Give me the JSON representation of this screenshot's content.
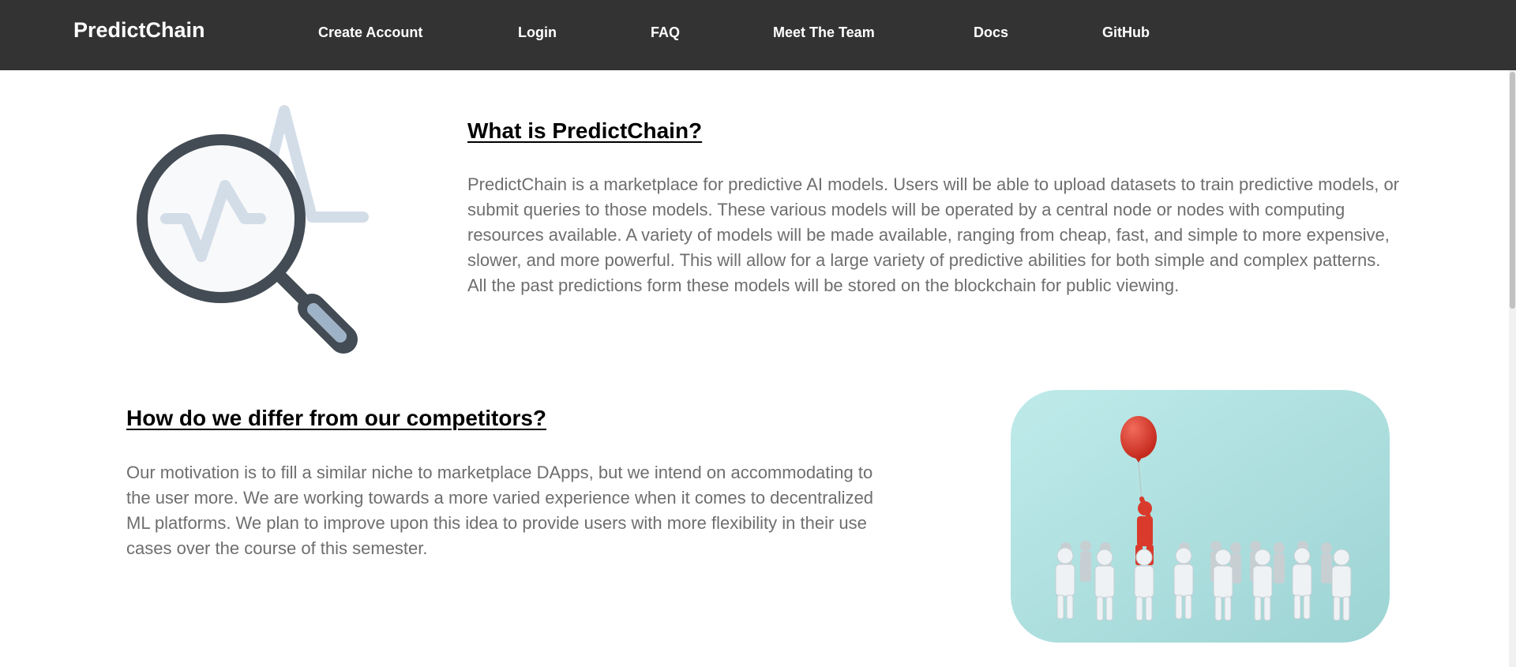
{
  "nav": {
    "brand": "PredictChain",
    "links": [
      "Create Account",
      "Login",
      "FAQ",
      "Meet The Team",
      "Docs",
      "GitHub"
    ]
  },
  "section_what": {
    "heading": "What is PredictChain?",
    "body": "PredictChain is a marketplace for predictive AI models. Users will be able to upload datasets to train predictive models, or submit queries to those models. These various models will be operated by a central node or nodes with computing resources available. A variety of models will be made available, ranging from cheap, fast, and simple to more expensive, slower, and more powerful. This will allow for a large variety of predictive abilities for both simple and complex patterns. All the past predictions form these models will be stored on the blockchain for public viewing.",
    "image_icon": "magnifier-with-chart-icon"
  },
  "section_differ": {
    "heading": "How do we differ from our competitors?",
    "body": "Our motivation is to fill a similar niche to marketplace DApps, but we intend on accommodating to the user more. We are working towards a more varied experience when it comes to decentralized ML platforms. We plan to improve upon this idea to provide users with more flexibility in their use cases over the course of this semester.",
    "image_icon": "crowd-with-red-balloon-figure"
  },
  "colors": {
    "navbar": "#333333",
    "accent_red": "#d93a2b",
    "photo_bg": "#a9dcdc",
    "icon_dark": "#434b54",
    "icon_light": "#d3dde8"
  }
}
